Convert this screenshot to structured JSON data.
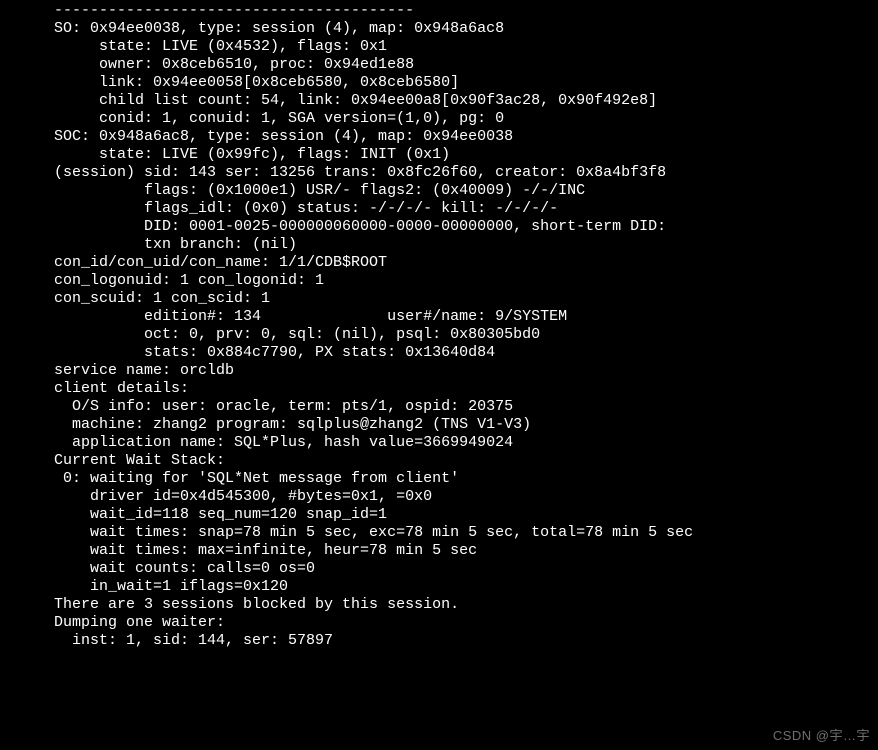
{
  "terminal": {
    "lines": [
      "      ----------------------------------------",
      "      SO: 0x94ee0038, type: session (4), map: 0x948a6ac8",
      "           state: LIVE (0x4532), flags: 0x1",
      "           owner: 0x8ceb6510, proc: 0x94ed1e88",
      "           link: 0x94ee0058[0x8ceb6580, 0x8ceb6580]",
      "           child list count: 54, link: 0x94ee00a8[0x90f3ac28, 0x90f492e8]",
      "           conid: 1, conuid: 1, SGA version=(1,0), pg: 0",
      "      SOC: 0x948a6ac8, type: session (4), map: 0x94ee0038",
      "           state: LIVE (0x99fc), flags: INIT (0x1)",
      "      (session) sid: 143 ser: 13256 trans: 0x8fc26f60, creator: 0x8a4bf3f8",
      "                flags: (0x1000e1) USR/- flags2: (0x40009) -/-/INC",
      "                flags_idl: (0x0) status: -/-/-/- kill: -/-/-/-",
      "                DID: 0001-0025-000000060000-0000-00000000, short-term DID:",
      "                txn branch: (nil)",
      "      con_id/con_uid/con_name: 1/1/CDB$ROOT",
      "      con_logonuid: 1 con_logonid: 1",
      "      con_scuid: 1 con_scid: 1",
      "                edition#: 134              user#/name: 9/SYSTEM",
      "                oct: 0, prv: 0, sql: (nil), psql: 0x80305bd0",
      "                stats: 0x884c7790, PX stats: 0x13640d84",
      "      service name: orcldb",
      "      client details:",
      "        O/S info: user: oracle, term: pts/1, ospid: 20375",
      "        machine: zhang2 program: sqlplus@zhang2 (TNS V1-V3)",
      "        application name: SQL*Plus, hash value=3669949024",
      "      Current Wait Stack:",
      "       0: waiting for 'SQL*Net message from client'",
      "          driver id=0x4d545300, #bytes=0x1, =0x0",
      "          wait_id=118 seq_num=120 snap_id=1",
      "          wait times: snap=78 min 5 sec, exc=78 min 5 sec, total=78 min 5 sec",
      "          wait times: max=infinite, heur=78 min 5 sec",
      "          wait counts: calls=0 os=0",
      "          in_wait=1 iflags=0x120",
      "      There are 3 sessions blocked by this session.",
      "      Dumping one waiter:",
      "        inst: 1, sid: 144, ser: 57897"
    ]
  },
  "so": {
    "addr": "0x94ee0038",
    "type": "session (4)",
    "map": "0x948a6ac8",
    "state": "LIVE (0x4532)",
    "flags": "0x1",
    "owner": "0x8ceb6510",
    "proc": "0x94ed1e88",
    "link": "0x94ee0058[0x8ceb6580, 0x8ceb6580]",
    "child_list_count": 54,
    "child_link": "0x94ee00a8[0x90f3ac28, 0x90f492e8]",
    "conid": 1,
    "conuid": 1,
    "sga_version": "(1,0)",
    "pg": 0
  },
  "soc": {
    "addr": "0x948a6ac8",
    "type": "session (4)",
    "map": "0x94ee0038",
    "state": "LIVE (0x99fc)",
    "flags": "INIT (0x1)"
  },
  "session": {
    "sid": 143,
    "ser": 13256,
    "trans": "0x8fc26f60",
    "creator": "0x8a4bf3f8",
    "flags": "(0x1000e1) USR/-",
    "flags2": "(0x40009) -/-/INC",
    "flags_idl": "(0x0)",
    "status": "-/-/-/-",
    "kill": "-/-/-/-",
    "DID": "0001-0025-000000060000-0000-00000000",
    "short_term_DID": "",
    "txn_branch": "(nil)"
  },
  "con": {
    "con_id": 1,
    "con_uid": 1,
    "con_name": "CDB$ROOT",
    "con_logonuid": 1,
    "con_logonid": 1,
    "con_scuid": 1,
    "con_scid": 1
  },
  "edition_user": {
    "edition_num": 134,
    "user_num": 9,
    "user_name": "SYSTEM",
    "oct": 0,
    "prv": 0,
    "sql": "(nil)",
    "psql": "0x80305bd0",
    "stats": "0x884c7790",
    "px_stats": "0x13640d84"
  },
  "service_name": "orcldb",
  "client_details": {
    "os_user": "oracle",
    "term": "pts/1",
    "ospid": 20375,
    "machine": "zhang2",
    "program": "sqlplus@zhang2 (TNS V1-V3)",
    "application_name": "SQL*Plus",
    "hash_value": 3669949024
  },
  "current_wait_stack": {
    "index": 0,
    "event": "SQL*Net message from client",
    "driver_id": "0x4d545300",
    "bytes": "0x1",
    "extra": "0x0",
    "wait_id": 118,
    "seq_num": 120,
    "snap_id": 1,
    "wait_times_snap": "78 min 5 sec",
    "wait_times_exc": "78 min 5 sec",
    "wait_times_total": "78 min 5 sec",
    "wait_times_max": "infinite",
    "wait_times_heur": "78 min 5 sec",
    "wait_counts_calls": 0,
    "wait_counts_os": 0,
    "in_wait": 1,
    "iflags": "0x120"
  },
  "blocked_sessions_count": 3,
  "waiter": {
    "inst": 1,
    "sid": 144,
    "ser": 57897
  },
  "watermark": "CSDN @宇…宇"
}
